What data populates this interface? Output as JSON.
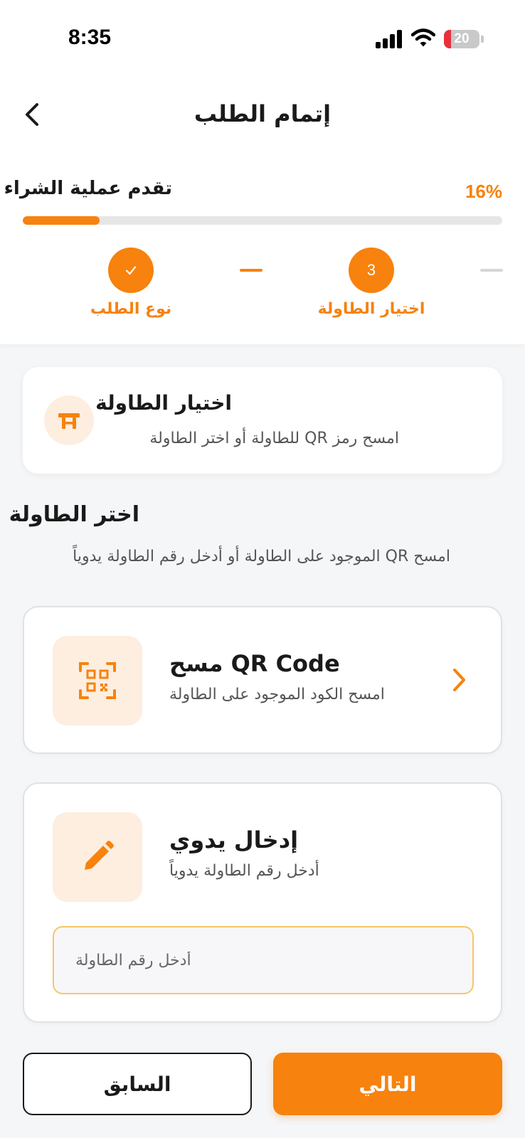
{
  "status_bar": {
    "time": "8:35",
    "battery_level": "20",
    "icons": [
      "signal-icon",
      "wifi-icon",
      "battery-icon"
    ]
  },
  "header": {
    "title": "إتمام الطلب",
    "back_icon": "chevron-left-icon"
  },
  "progress": {
    "title": "تقدم عملية الشراء",
    "percent_label": "16%",
    "value": 16
  },
  "steps": [
    {
      "label": "نوع الطلب",
      "state": "completed",
      "icon": "check-icon"
    },
    {
      "label": "اختيار الطاولة",
      "state": "active",
      "number": "3"
    }
  ],
  "info_card": {
    "icon": "table-icon",
    "title": "اختيار الطاولة",
    "subtitle": "امسح رمز QR للطاولة أو اختر الطاولة"
  },
  "section": {
    "title": "اختر الطاولة",
    "subtitle": "امسح QR الموجود على الطاولة أو أدخل رقم الطاولة يدوياً"
  },
  "options": {
    "qr": {
      "icon": "qr-code-icon",
      "title": "مسح QR Code",
      "subtitle": "امسح الكود الموجود على الطاولة",
      "chevron_icon": "chevron-right-icon"
    },
    "manual": {
      "icon": "pencil-icon",
      "title": "إدخال يدوي",
      "subtitle": "أدخل رقم الطاولة يدوياً",
      "input_placeholder": "أدخل رقم الطاولة",
      "input_value": ""
    }
  },
  "buttons": {
    "previous": "السابق",
    "next": "التالي"
  },
  "colors": {
    "accent": "#f7820d",
    "accent_soft": "#fdeee0",
    "input_border": "#f4c76a",
    "battery_low": "#e8303a"
  }
}
